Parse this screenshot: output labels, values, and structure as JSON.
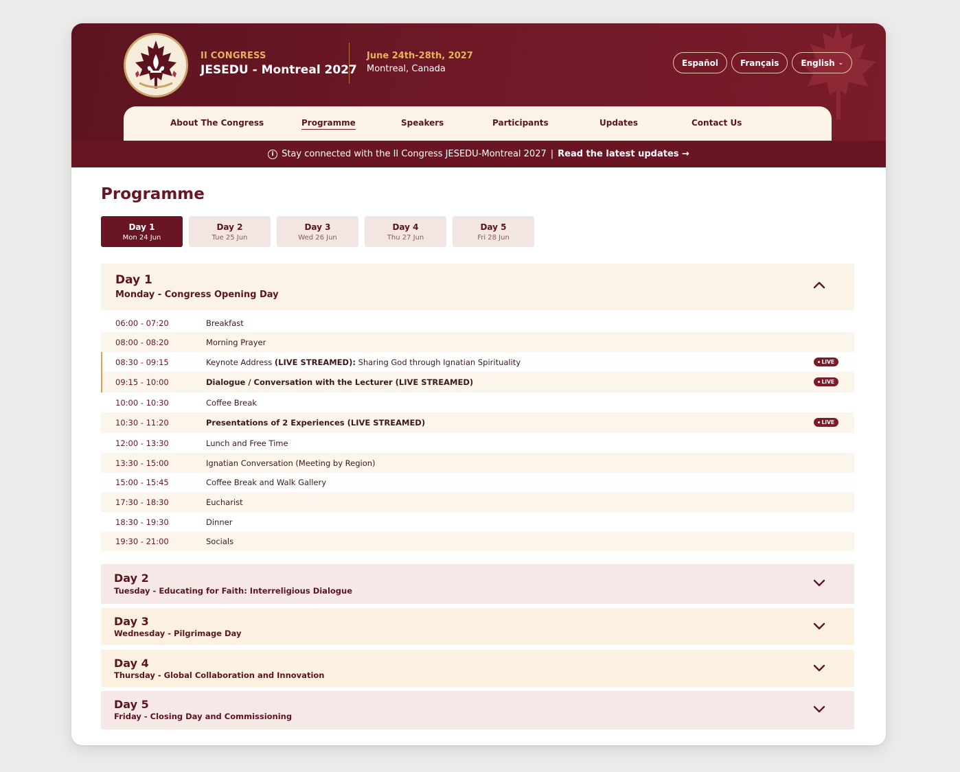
{
  "header": {
    "kicker": "II CONGRESS",
    "title": "JESEDU - Montreal 2027",
    "date": "June 24th-28th, 2027",
    "place": "Montreal, Canada",
    "languages": [
      "Español",
      "Français",
      "English"
    ],
    "active_language_chevron": "chevron-down-icon"
  },
  "nav": {
    "items": [
      "About The Congress",
      "Programme",
      "Speakers",
      "Participants",
      "Updates",
      "Contact Us"
    ],
    "active": "Programme"
  },
  "banner": {
    "icon": "info-icon",
    "text": "Stay connected with the II Congress JESEDU-Montreal 2027",
    "separator": "|",
    "link": "Read the latest updates →"
  },
  "page": {
    "title": "Programme"
  },
  "tabs": [
    {
      "day": "Day 1",
      "date": "Mon 24 Jun"
    },
    {
      "day": "Day 2",
      "date": "Tue 25 Jun"
    },
    {
      "day": "Day 3",
      "date": "Wed 26 Jun"
    },
    {
      "day": "Day 4",
      "date": "Thu 27 Jun"
    },
    {
      "day": "Day 5",
      "date": "Fri 28 Jun"
    }
  ],
  "open_day": {
    "title": "Day 1",
    "subtitle": "Monday - Congress Opening Day",
    "live_label": "LIVE",
    "rows": [
      {
        "time": "06:00 - 07:20",
        "title": "Breakfast"
      },
      {
        "time": "08:00 - 08:20",
        "title": "Morning Prayer"
      },
      {
        "time": "08:30 - 09:15",
        "title_pre": "Keynote Address ",
        "title_bold": "(LIVE STREAMED):",
        "title_post": " Sharing God through Ignatian Spirituality",
        "live": true
      },
      {
        "time": "09:15 - 10:00",
        "title": "Dialogue / Conversation with the Lecturer (LIVE STREAMED)",
        "live": true
      },
      {
        "time": "10:00 - 10:30",
        "title": "Coffee Break"
      },
      {
        "time": "10:30 - 11:20",
        "title": "Presentations of 2 Experiences (LIVE STREAMED)",
        "live": true
      },
      {
        "time": "12:00 - 13:30",
        "title": "Lunch and Free Time"
      },
      {
        "time": "13:30 - 15:00",
        "title": "Ignatian Conversation (Meeting by Region)"
      },
      {
        "time": "15:00 - 15:45",
        "title": "Coffee Break and Walk Gallery"
      },
      {
        "time": "17:30 - 18:30",
        "title": "Eucharist"
      },
      {
        "time": "18:30 - 19:30",
        "title": "Dinner"
      },
      {
        "time": "19:30 - 21:00",
        "title": "Socials"
      }
    ]
  },
  "collapsed_days": [
    {
      "title": "Day 2",
      "subtitle": "Tuesday - Educating for Faith: Interreligious Dialogue"
    },
    {
      "title": "Day 3",
      "subtitle": "Wednesday - Pilgrimage Day"
    },
    {
      "title": "Day 4",
      "subtitle": "Thursday - Global Collaboration and Innovation"
    },
    {
      "title": "Day 5",
      "subtitle": "Friday - Closing Day and Commissioning"
    }
  ],
  "colors": {
    "brand_maroon": "#6a1524",
    "gold": "#e7b25c",
    "cream": "#fbf3e6",
    "pink": "#f7e8e8"
  }
}
